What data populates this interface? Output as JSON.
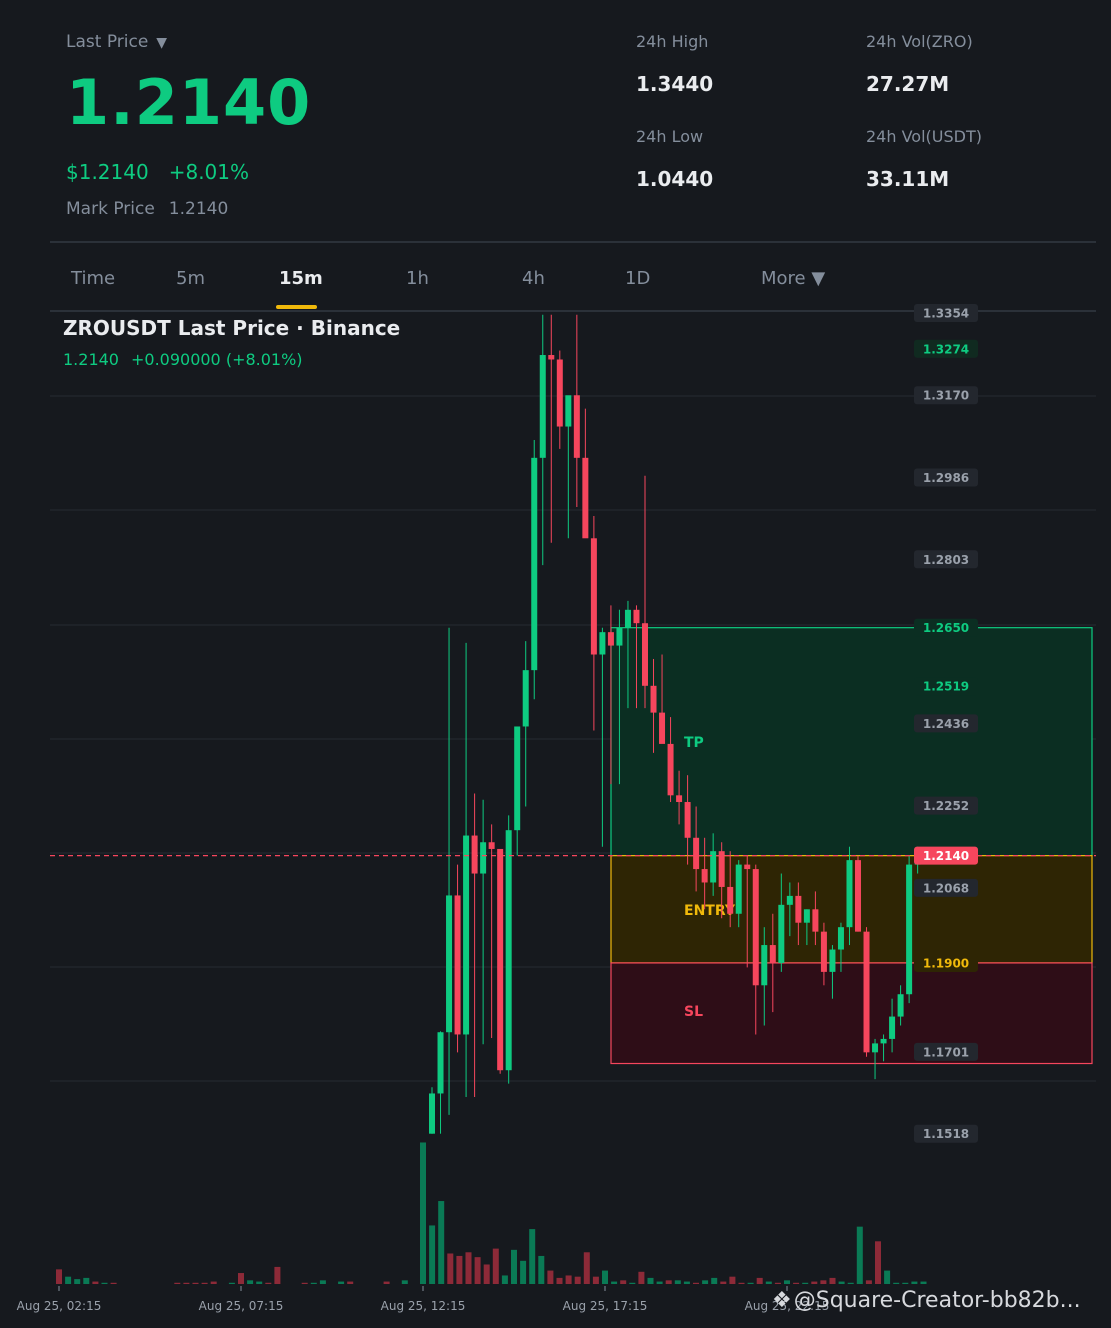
{
  "header": {
    "last_price_label": "Last Price",
    "last_price": "1.2140",
    "fiat_price": "$1.2140",
    "change_pct": "+8.01%",
    "mark_price_label": "Mark Price",
    "mark_price": "1.2140"
  },
  "stats": {
    "high_label": "24h High",
    "high": "1.3440",
    "low_label": "24h Low",
    "low": "1.0440",
    "vol_base_label": "24h Vol(ZRO)",
    "vol_base": "27.27M",
    "vol_quote_label": "24h Vol(USDT)",
    "vol_quote": "33.11M"
  },
  "tabs": [
    {
      "label": "Time"
    },
    {
      "label": "5m"
    },
    {
      "label": "15m",
      "active": true
    },
    {
      "label": "1h"
    },
    {
      "label": "4h"
    },
    {
      "label": "1D"
    },
    {
      "label": "More ▼"
    }
  ],
  "chart": {
    "title": "ZROUSDT Last Price · Binance",
    "last": "1.2140",
    "change_abs": "+0.090000 (+8.01%)"
  },
  "watermark": "@Square-Creator-bb82b...",
  "colors": {
    "up": "#0ecb81",
    "down": "#f6465d",
    "accent": "#f0b90b",
    "bg": "#16191e"
  },
  "chart_data": {
    "type": "candlestick",
    "ylim": [
      1.1518,
      1.3354
    ],
    "price_ticks": [
      "1.3354",
      "1.3170",
      "1.2986",
      "1.2803",
      "1.2436",
      "1.2252",
      "1.2068",
      "1.1701",
      "1.1518"
    ],
    "marker_labels": [
      {
        "value": "1.3274",
        "role": "high"
      },
      {
        "value": "1.2650",
        "role": "tp"
      },
      {
        "value": "1.2519",
        "role": "level"
      },
      {
        "value": "1.2140",
        "role": "last"
      },
      {
        "value": "1.1900",
        "role": "entry"
      }
    ],
    "x_ticks": [
      "Aug 25, 02:15",
      "Aug 25, 07:15",
      "Aug 25, 12:15",
      "Aug 25, 17:15",
      "Aug 25, 22:15"
    ],
    "current_price": 1.214,
    "position": {
      "take_profit": {
        "label": "TP",
        "price": 1.265
      },
      "entry": {
        "label": "ENTRY",
        "price": 1.214
      },
      "stop_loss": {
        "label": "SL",
        "price": 1.19,
        "bottom": 1.1675
      }
    },
    "candles": [
      {
        "o": 1.1518,
        "h": 1.1622,
        "l": 1.1518,
        "c": 1.1608
      },
      {
        "o": 1.1608,
        "h": 1.1747,
        "l": 1.1518,
        "c": 1.1745
      },
      {
        "o": 1.1745,
        "h": 1.265,
        "l": 1.156,
        "c": 1.2051
      },
      {
        "o": 1.2051,
        "h": 1.212,
        "l": 1.17,
        "c": 1.174
      },
      {
        "o": 1.174,
        "h": 1.2616,
        "l": 1.16,
        "c": 1.2185
      },
      {
        "o": 1.2185,
        "h": 1.2279,
        "l": 1.16,
        "c": 1.21
      },
      {
        "o": 1.21,
        "h": 1.2265,
        "l": 1.1718,
        "c": 1.217
      },
      {
        "o": 1.217,
        "h": 1.221,
        "l": 1.1732,
        "c": 1.2155
      },
      {
        "o": 1.2155,
        "h": 1.2155,
        "l": 1.1652,
        "c": 1.166
      },
      {
        "o": 1.166,
        "h": 1.223,
        "l": 1.163,
        "c": 1.2197
      },
      {
        "o": 1.2197,
        "h": 1.24,
        "l": 1.214,
        "c": 1.2429
      },
      {
        "o": 1.2429,
        "h": 1.262,
        "l": 1.225,
        "c": 1.2555
      },
      {
        "o": 1.2555,
        "h": 1.307,
        "l": 1.249,
        "c": 1.303
      },
      {
        "o": 1.303,
        "h": 1.335,
        "l": 1.279,
        "c": 1.326
      },
      {
        "o": 1.326,
        "h": 1.335,
        "l": 1.284,
        "c": 1.325
      },
      {
        "o": 1.325,
        "h": 1.327,
        "l": 1.305,
        "c": 1.31
      },
      {
        "o": 1.31,
        "h": 1.314,
        "l": 1.285,
        "c": 1.317
      },
      {
        "o": 1.317,
        "h": 1.335,
        "l": 1.292,
        "c": 1.303
      },
      {
        "o": 1.303,
        "h": 1.314,
        "l": 1.287,
        "c": 1.285
      },
      {
        "o": 1.285,
        "h": 1.29,
        "l": 1.242,
        "c": 1.259
      },
      {
        "o": 1.259,
        "h": 1.265,
        "l": 1.216,
        "c": 1.264
      },
      {
        "o": 1.264,
        "h": 1.27,
        "l": 1.23,
        "c": 1.261
      },
      {
        "o": 1.261,
        "h": 1.269,
        "l": 1.23,
        "c": 1.265
      },
      {
        "o": 1.265,
        "h": 1.271,
        "l": 1.247,
        "c": 1.269
      },
      {
        "o": 1.269,
        "h": 1.27,
        "l": 1.247,
        "c": 1.266
      },
      {
        "o": 1.266,
        "h": 1.299,
        "l": 1.247,
        "c": 1.252
      },
      {
        "o": 1.252,
        "h": 1.258,
        "l": 1.237,
        "c": 1.246
      },
      {
        "o": 1.246,
        "h": 1.259,
        "l": 1.24,
        "c": 1.239
      },
      {
        "o": 1.239,
        "h": 1.245,
        "l": 1.226,
        "c": 1.2275
      },
      {
        "o": 1.2275,
        "h": 1.233,
        "l": 1.221,
        "c": 1.226
      },
      {
        "o": 1.226,
        "h": 1.232,
        "l": 1.212,
        "c": 1.218
      },
      {
        "o": 1.218,
        "h": 1.225,
        "l": 1.206,
        "c": 1.211
      },
      {
        "o": 1.211,
        "h": 1.218,
        "l": 1.202,
        "c": 1.208
      },
      {
        "o": 1.208,
        "h": 1.219,
        "l": 1.205,
        "c": 1.215
      },
      {
        "o": 1.215,
        "h": 1.217,
        "l": 1.2,
        "c": 1.207
      },
      {
        "o": 1.207,
        "h": 1.215,
        "l": 1.198,
        "c": 1.201
      },
      {
        "o": 1.201,
        "h": 1.213,
        "l": 1.198,
        "c": 1.212
      },
      {
        "o": 1.212,
        "h": 1.214,
        "l": 1.189,
        "c": 1.211
      },
      {
        "o": 1.211,
        "h": 1.212,
        "l": 1.174,
        "c": 1.185
      },
      {
        "o": 1.185,
        "h": 1.198,
        "l": 1.176,
        "c": 1.194
      },
      {
        "o": 1.194,
        "h": 1.201,
        "l": 1.179,
        "c": 1.19
      },
      {
        "o": 1.19,
        "h": 1.21,
        "l": 1.188,
        "c": 1.203
      },
      {
        "o": 1.203,
        "h": 1.208,
        "l": 1.196,
        "c": 1.205
      },
      {
        "o": 1.205,
        "h": 1.208,
        "l": 1.194,
        "c": 1.199
      },
      {
        "o": 1.199,
        "h": 1.202,
        "l": 1.194,
        "c": 1.202
      },
      {
        "o": 1.202,
        "h": 1.206,
        "l": 1.194,
        "c": 1.197
      },
      {
        "o": 1.197,
        "h": 1.199,
        "l": 1.185,
        "c": 1.188
      },
      {
        "o": 1.188,
        "h": 1.194,
        "l": 1.182,
        "c": 1.193
      },
      {
        "o": 1.193,
        "h": 1.199,
        "l": 1.188,
        "c": 1.198
      },
      {
        "o": 1.198,
        "h": 1.216,
        "l": 1.194,
        "c": 1.213
      },
      {
        "o": 1.213,
        "h": 1.214,
        "l": 1.197,
        "c": 1.197
      },
      {
        "o": 1.197,
        "h": 1.198,
        "l": 1.169,
        "c": 1.17
      },
      {
        "o": 1.17,
        "h": 1.173,
        "l": 1.164,
        "c": 1.172
      },
      {
        "o": 1.172,
        "h": 1.174,
        "l": 1.168,
        "c": 1.173
      },
      {
        "o": 1.173,
        "h": 1.182,
        "l": 1.17,
        "c": 1.178
      },
      {
        "o": 1.178,
        "h": 1.185,
        "l": 1.176,
        "c": 1.183
      },
      {
        "o": 1.183,
        "h": 1.214,
        "l": 1.181,
        "c": 1.212
      },
      {
        "o": 1.212,
        "h": 1.216,
        "l": 1.21,
        "c": 1.214
      }
    ],
    "volume": [
      {
        "v": 12,
        "up": false
      },
      {
        "v": 6,
        "up": true
      },
      {
        "v": 4,
        "up": true
      },
      {
        "v": 5,
        "up": true
      },
      {
        "v": 2,
        "up": false
      },
      {
        "v": 1,
        "up": true
      },
      {
        "v": 1,
        "up": false
      },
      {
        "v": 0,
        "up": true
      },
      {
        "v": 0,
        "up": true
      },
      {
        "v": 0,
        "up": true
      },
      {
        "v": 0,
        "up": true
      },
      {
        "v": 0,
        "up": true
      },
      {
        "v": 0,
        "up": true
      },
      {
        "v": 1,
        "up": false
      },
      {
        "v": 1,
        "up": false
      },
      {
        "v": 1,
        "up": false
      },
      {
        "v": 1,
        "up": false
      },
      {
        "v": 2,
        "up": false
      },
      {
        "v": 0,
        "up": true
      },
      {
        "v": 1,
        "up": true
      },
      {
        "v": 9,
        "up": false
      },
      {
        "v": 3,
        "up": true
      },
      {
        "v": 2,
        "up": true
      },
      {
        "v": 1,
        "up": false
      },
      {
        "v": 14,
        "up": false
      },
      {
        "v": 0,
        "up": true
      },
      {
        "v": 0,
        "up": true
      },
      {
        "v": 1,
        "up": false
      },
      {
        "v": 1,
        "up": true
      },
      {
        "v": 3,
        "up": true
      },
      {
        "v": 0,
        "up": true
      },
      {
        "v": 2,
        "up": true
      },
      {
        "v": 2,
        "up": false
      },
      {
        "v": 0,
        "up": true
      },
      {
        "v": 0,
        "up": true
      },
      {
        "v": 0,
        "up": true
      },
      {
        "v": 2,
        "up": false
      },
      {
        "v": 0,
        "up": true
      },
      {
        "v": 3,
        "up": true
      },
      {
        "v": 0,
        "up": true
      },
      {
        "v": 116,
        "up": true
      },
      {
        "v": 48,
        "up": true
      },
      {
        "v": 68,
        "up": true
      },
      {
        "v": 25,
        "up": false
      },
      {
        "v": 23,
        "up": false
      },
      {
        "v": 26,
        "up": false
      },
      {
        "v": 22,
        "up": false
      },
      {
        "v": 16,
        "up": false
      },
      {
        "v": 29,
        "up": false
      },
      {
        "v": 7,
        "up": true
      },
      {
        "v": 28,
        "up": true
      },
      {
        "v": 19,
        "up": true
      },
      {
        "v": 45,
        "up": true
      },
      {
        "v": 23,
        "up": true
      },
      {
        "v": 11,
        "up": false
      },
      {
        "v": 5,
        "up": false
      },
      {
        "v": 7,
        "up": false
      },
      {
        "v": 6,
        "up": false
      },
      {
        "v": 26,
        "up": false
      },
      {
        "v": 6,
        "up": false
      },
      {
        "v": 11,
        "up": true
      },
      {
        "v": 2,
        "up": true
      },
      {
        "v": 3,
        "up": false
      },
      {
        "v": 1,
        "up": true
      },
      {
        "v": 10,
        "up": false
      },
      {
        "v": 5,
        "up": true
      },
      {
        "v": 2,
        "up": true
      },
      {
        "v": 3,
        "up": false
      },
      {
        "v": 3,
        "up": true
      },
      {
        "v": 2,
        "up": true
      },
      {
        "v": 1,
        "up": false
      },
      {
        "v": 3,
        "up": true
      },
      {
        "v": 5,
        "up": true
      },
      {
        "v": 2,
        "up": false
      },
      {
        "v": 6,
        "up": false
      },
      {
        "v": 1,
        "up": false
      },
      {
        "v": 1,
        "up": true
      },
      {
        "v": 5,
        "up": false
      },
      {
        "v": 2,
        "up": true
      },
      {
        "v": 1,
        "up": false
      },
      {
        "v": 3,
        "up": true
      },
      {
        "v": 1,
        "up": false
      },
      {
        "v": 1,
        "up": true
      },
      {
        "v": 2,
        "up": false
      },
      {
        "v": 3,
        "up": false
      },
      {
        "v": 5,
        "up": false
      },
      {
        "v": 2,
        "up": true
      },
      {
        "v": 1,
        "up": true
      },
      {
        "v": 47,
        "up": true
      },
      {
        "v": 3,
        "up": false
      },
      {
        "v": 35,
        "up": false
      },
      {
        "v": 11,
        "up": true
      },
      {
        "v": 1,
        "up": true
      },
      {
        "v": 1,
        "up": true
      },
      {
        "v": 2,
        "up": true
      },
      {
        "v": 2,
        "up": true
      }
    ]
  }
}
